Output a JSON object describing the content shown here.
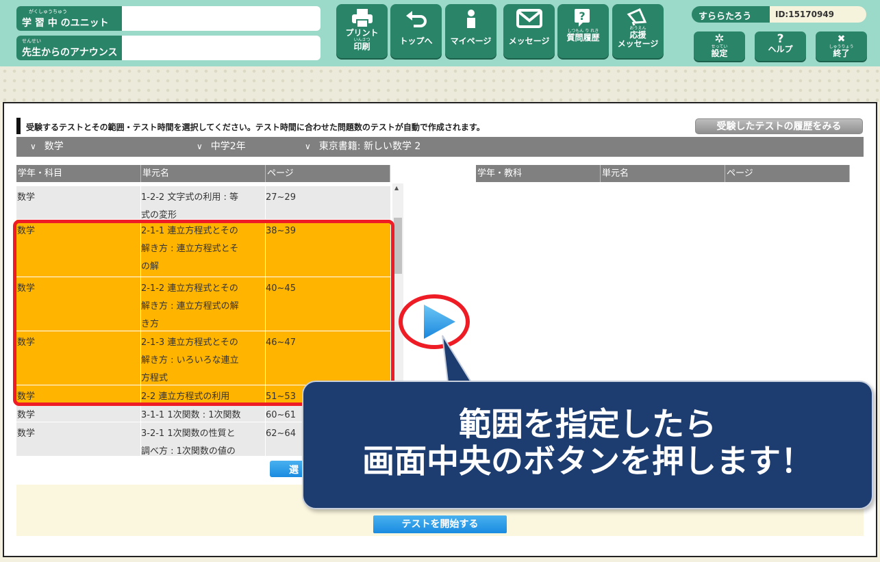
{
  "header": {
    "learning_unit": {
      "label": "学 習 中 のユニット",
      "ruby": "がくしゅうちゅう",
      "value": ""
    },
    "announcement": {
      "label": "先生からのアナウンス",
      "ruby": "せんせい",
      "value": ""
    },
    "nav": [
      {
        "label": "プリント",
        "sub_ruby": "いんさつ",
        "label2": "印刷",
        "icon": "printer-icon"
      },
      {
        "label": "トップへ",
        "icon": "return-arrow-icon"
      },
      {
        "label": "マイページ",
        "icon": "person-icon"
      },
      {
        "label": "メッセージ",
        "icon": "envelope-icon"
      },
      {
        "ruby": "しつもん り れき",
        "label": "質問履歴",
        "icon": "question-bubble-icon"
      },
      {
        "ruby": "おうえん",
        "label": "応援",
        "label2": "メッセージ",
        "icon": "megaphone-icon"
      }
    ],
    "user": {
      "name": "すららたろう",
      "id": "ID:15170949"
    },
    "system": [
      {
        "glyph": "✲",
        "ruby": "せってい",
        "label": "設定",
        "icon": "gear-icon"
      },
      {
        "glyph": "?",
        "ruby": "",
        "label": "ヘルプ",
        "icon": "help-icon"
      },
      {
        "glyph": "✖",
        "ruby": "しゅうりょう",
        "label": "終了",
        "icon": "close-icon"
      }
    ]
  },
  "main": {
    "instruction": "受験するテストとその範囲・テスト時間を選択してください。テスト時間に合わせた問題数のテストが自動で作成されます。",
    "history_button": "受験したテストの履歴をみる",
    "filters": [
      {
        "chevron": "∨",
        "value": "数学"
      },
      {
        "chevron": "∨",
        "value": "中学2年"
      },
      {
        "chevron": "∨",
        "value": "東京書籍: 新しい数学 2"
      }
    ],
    "left_headers": [
      "学年・科目",
      "単元名",
      "ページ"
    ],
    "right_headers": [
      "学年・教科",
      "単元名",
      "ページ"
    ],
    "units": [
      {
        "subject": "数学",
        "unit_lines": [
          "1-2-2 文字式の利用 : 等",
          "式の変形"
        ],
        "pages": "27~29",
        "selected": false
      },
      {
        "subject": "数学",
        "unit_lines": [
          "2-1-1 連立方程式とその",
          "解き方 : 連立方程式とそ",
          "の解"
        ],
        "pages": "38~39",
        "selected": true
      },
      {
        "subject": "数学",
        "unit_lines": [
          "2-1-2 連立方程式とその",
          "解き方 : 連立方程式の解",
          "き方"
        ],
        "pages": "40~45",
        "selected": true
      },
      {
        "subject": "数学",
        "unit_lines": [
          "2-1-3 連立方程式とその",
          "解き方 : いろいろな連立",
          "方程式"
        ],
        "pages": "46~47",
        "selected": true
      },
      {
        "subject": "数学",
        "unit_lines": [
          "2-2 連立方程式の利用"
        ],
        "pages": "51~53",
        "selected": true
      },
      {
        "subject": "数学",
        "unit_lines": [
          "3-1-1 1次関数 : 1次関数"
        ],
        "pages": "60~61",
        "selected": false
      },
      {
        "subject": "数学",
        "unit_lines": [
          "3-2-1 1次関数の性質と",
          "調べ方 : 1次関数の値の"
        ],
        "pages": "62~64",
        "selected": false
      }
    ],
    "select_button": "選",
    "start_button": "テストを開始する"
  },
  "callout": {
    "line1": "範囲を指定したら",
    "line2": "画面中央のボタンを押します！"
  },
  "colors": {
    "header_bg": "#9bd9c9",
    "nav_green": "#2a8468",
    "selected_row": "#ffb400",
    "highlight_red": "#ee1c25",
    "callout_bg": "#1d3c70",
    "primary_blue": "#1a8be0"
  }
}
